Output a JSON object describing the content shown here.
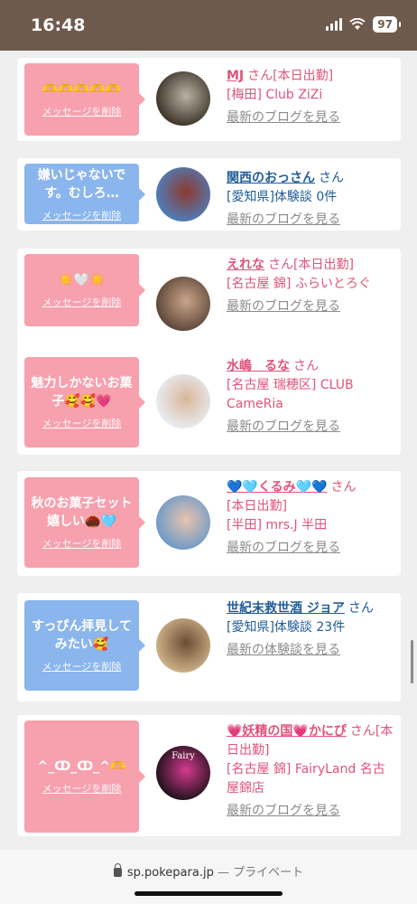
{
  "status_bar": {
    "time": "16:48",
    "battery": "97"
  },
  "messages": [
    {
      "bubble_color": "pink",
      "message": "🫶🫶🫶🫶🫶",
      "delete_label": "メッセージを削除",
      "name": "MJ",
      "name_color": "pink",
      "suffix": "さん[本日出勤]",
      "lines": [
        "[梅田] Club ZiZi"
      ],
      "line_color": "pink",
      "link": "最新のブログを見る",
      "avatar_colors": [
        "#3a3026",
        "#b9b3a4"
      ]
    },
    {
      "bubble_color": "blue",
      "message": "嫌いじゃないです。むしろ…",
      "delete_label": "メッセージを削除",
      "name": "関西のおっさん",
      "name_color": "blue",
      "suffix": "さん",
      "lines": [
        "[愛知県]体験談 0件"
      ],
      "line_color": "blue",
      "link": "最新のブログを見る",
      "avatar_colors": [
        "#4d7fbf",
        "#8c3a2e"
      ]
    },
    {
      "bubble_color": "pink",
      "message": "☀️🤍☀️",
      "delete_label": "メッセージを削除",
      "name": "えれな",
      "name_color": "pink",
      "suffix": "さん[本日出勤]",
      "lines": [
        "[名古屋 錦] ふらいとろぐ"
      ],
      "line_color": "pink",
      "link": "最新のブログを見る",
      "avatar_colors": [
        "#5a4436",
        "#caa58a"
      ]
    },
    {
      "bubble_color": "pink",
      "message": "魅力しかないお菓子🥰🥰💗",
      "delete_label": "メッセージを削除",
      "name": "水嶋　るな",
      "name_color": "pink",
      "suffix": "さん",
      "lines": [
        "[名古屋 瑞穂区] CLUB CameRia"
      ],
      "line_color": "pink",
      "link": "最新のブログを見る",
      "avatar_colors": [
        "#e9eef5",
        "#d9b79b"
      ]
    },
    {
      "bubble_color": "pink",
      "message": "秋のお菓子セット嬉しい🌰🩵",
      "delete_label": "メッセージを削除",
      "name": "💙🩵くるみ🩵💙",
      "name_color": "pink",
      "suffix": "さん",
      "lines": [
        "[本日出勤]",
        "[半田] mrs.J 半田"
      ],
      "line_color": "pink",
      "link": "最新のブログを見る",
      "avatar_colors": [
        "#6a99c8",
        "#e8c3ae"
      ]
    },
    {
      "bubble_color": "blue",
      "message": "すっぴん拝見してみたい🥰",
      "delete_label": "メッセージを削除",
      "name": "世紀末救世酒 ジョア",
      "name_color": "blue",
      "suffix": "さん",
      "lines": [
        "[愛知県]体験談 23件"
      ],
      "line_color": "blue",
      "link": "最新の体験談を見る",
      "avatar_colors": [
        "#d2b58c",
        "#6b4d33"
      ]
    },
    {
      "bubble_color": "pink",
      "message": "^_ↀ_ↀ_^🫶",
      "delete_label": "メッセージを削除",
      "name": "💗妖精の国💗かにぴ",
      "name_color": "pink",
      "suffix": "さん[本日出勤]",
      "lines": [
        "[名古屋 錦] FairyLand 名古屋錦店"
      ],
      "line_color": "pink",
      "link": "最新のブログを見る",
      "avatar_colors": [
        "#1a1018",
        "#d63a8e"
      ],
      "avatar_text": "Fairy"
    }
  ],
  "url_bar": {
    "domain": "sp.pokepara.jp",
    "separator": "—",
    "mode": "プライベート"
  }
}
